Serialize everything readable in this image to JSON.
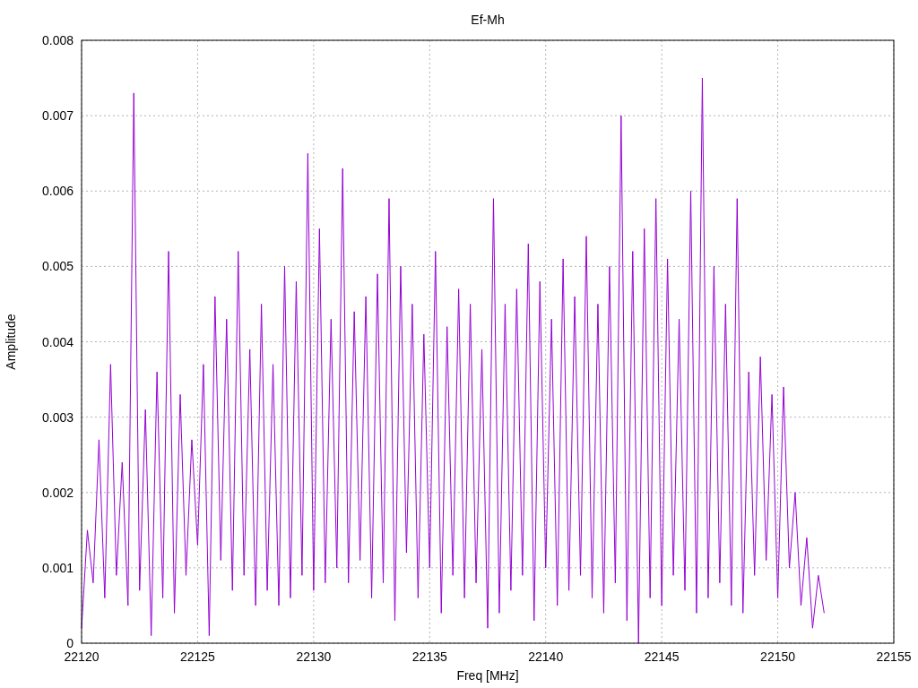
{
  "chart_data": {
    "type": "line",
    "grid": true,
    "title": "Ef-Mh",
    "xlabel": "Freq [MHz]",
    "ylabel": "Amplitude",
    "xlim": [
      22120,
      22155
    ],
    "ylim": [
      0,
      0.008
    ],
    "xticks": [
      22120,
      22125,
      22130,
      22135,
      22140,
      22145,
      22150,
      22155
    ],
    "yticks": [
      {
        "value": 0,
        "label": "0"
      },
      {
        "value": 0.001,
        "label": "0.001"
      },
      {
        "value": 0.002,
        "label": "0.002"
      },
      {
        "value": 0.003,
        "label": "0.003"
      },
      {
        "value": 0.004,
        "label": "0.004"
      },
      {
        "value": 0.005,
        "label": "0.005"
      },
      {
        "value": 0.006,
        "label": "0.006"
      },
      {
        "value": 0.007,
        "label": "0.007"
      },
      {
        "value": 0.008,
        "label": "0.008"
      }
    ],
    "x": [
      22120,
      22120.25,
      22120.5,
      22120.75,
      22121,
      22121.25,
      22121.5,
      22121.75,
      22122,
      22122.25,
      22122.5,
      22122.75,
      22123,
      22123.25,
      22123.5,
      22123.75,
      22124,
      22124.25,
      22124.5,
      22124.75,
      22125,
      22125.25,
      22125.5,
      22125.75,
      22126,
      22126.25,
      22126.5,
      22126.75,
      22127,
      22127.25,
      22127.5,
      22127.75,
      22128,
      22128.25,
      22128.5,
      22128.75,
      22129,
      22129.25,
      22129.5,
      22129.75,
      22130,
      22130.25,
      22130.5,
      22130.75,
      22131,
      22131.25,
      22131.5,
      22131.75,
      22132,
      22132.25,
      22132.5,
      22132.75,
      22133,
      22133.25,
      22133.5,
      22133.75,
      22134,
      22134.25,
      22134.5,
      22134.75,
      22135,
      22135.25,
      22135.5,
      22135.75,
      22136,
      22136.25,
      22136.5,
      22136.75,
      22137,
      22137.25,
      22137.5,
      22137.75,
      22138,
      22138.25,
      22138.5,
      22138.75,
      22139,
      22139.25,
      22139.5,
      22139.75,
      22140,
      22140.25,
      22140.5,
      22140.75,
      22141,
      22141.25,
      22141.5,
      22141.75,
      22142,
      22142.25,
      22142.5,
      22142.75,
      22143,
      22143.25,
      22143.5,
      22143.75,
      22144,
      22144.25,
      22144.5,
      22144.75,
      22145,
      22145.25,
      22145.5,
      22145.75,
      22146,
      22146.25,
      22146.5,
      22146.75,
      22147,
      22147.25,
      22147.5,
      22147.75,
      22148,
      22148.25,
      22148.5,
      22148.75,
      22149,
      22149.25,
      22149.5,
      22149.75,
      22150,
      22150.25,
      22150.5,
      22150.75,
      22151,
      22151.25,
      22151.5,
      22151.75,
      22152
    ],
    "series": [
      {
        "color": "#9400d3",
        "values": [
          0.0002,
          0.0015,
          0.0008,
          0.0027,
          0.0006,
          0.0037,
          0.0009,
          0.0024,
          0.0005,
          0.0073,
          0.0007,
          0.0031,
          0.0001,
          0.0036,
          0.0006,
          0.0052,
          0.0004,
          0.0033,
          0.0009,
          0.0027,
          0.0013,
          0.0037,
          0.0001,
          0.0046,
          0.0011,
          0.0043,
          0.0007,
          0.0052,
          0.0009,
          0.0039,
          0.0005,
          0.0045,
          0.0007,
          0.0037,
          0.0005,
          0.005,
          0.0006,
          0.0048,
          0.0009,
          0.0065,
          0.0007,
          0.0055,
          0.0008,
          0.0043,
          0.001,
          0.0063,
          0.0008,
          0.0044,
          0.0011,
          0.0046,
          0.0006,
          0.0049,
          0.0008,
          0.0059,
          0.0003,
          0.005,
          0.0012,
          0.0045,
          0.0006,
          0.0041,
          0.001,
          0.0052,
          0.0004,
          0.0042,
          0.0009,
          0.0047,
          0.0006,
          0.0045,
          0.0008,
          0.0039,
          0.0002,
          0.0059,
          0.0004,
          0.0045,
          0.0007,
          0.0047,
          0.0009,
          0.0053,
          0.0003,
          0.0048,
          0.001,
          0.0043,
          0.0005,
          0.0051,
          0.0007,
          0.0046,
          0.0009,
          0.0054,
          0.0006,
          0.0045,
          0.0004,
          0.005,
          0.0008,
          0.007,
          0.0003,
          0.0052,
          0.0,
          0.0055,
          0.0006,
          0.0059,
          0.0005,
          0.0051,
          0.0009,
          0.0043,
          0.0007,
          0.006,
          0.0004,
          0.0075,
          0.0006,
          0.005,
          0.0008,
          0.0045,
          0.0005,
          0.0059,
          0.0004,
          0.0036,
          0.0009,
          0.0038,
          0.0011,
          0.0033,
          0.0006,
          0.0034,
          0.001,
          0.002,
          0.0005,
          0.0014,
          0.0002,
          0.0009,
          0.0004
        ]
      }
    ]
  }
}
